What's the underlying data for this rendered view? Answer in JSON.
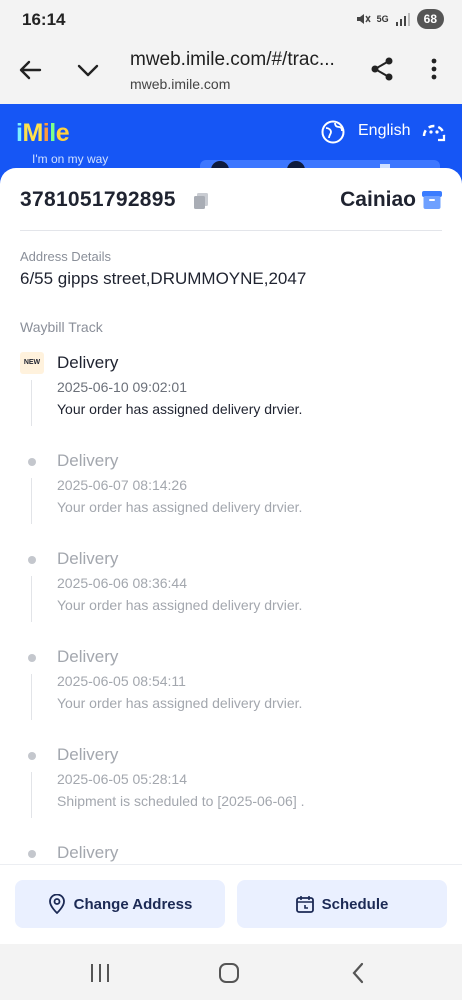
{
  "status_bar": {
    "time": "16:14",
    "network": "5G",
    "battery": "68",
    "icons": [
      "mute-icon",
      "signal-icon",
      "battery-icon"
    ]
  },
  "browser": {
    "url_main": "mweb.imile.com/#/trac...",
    "url_sub": "mweb.imile.com",
    "icons": [
      "back-arrow-icon",
      "chevron-down-icon",
      "share-icon",
      "more-vert-icon"
    ]
  },
  "header": {
    "logo": "iMile",
    "logo_colors": [
      "#7cf0ff",
      "#ffe14d",
      "#ff9a3d",
      "#7dff8a",
      "#ffd23f"
    ],
    "tagline": "I'm on my way",
    "language": "English",
    "accent_color": "#1656f5",
    "icons": [
      "globe-icon",
      "headset-icon"
    ]
  },
  "shipment": {
    "tracking_number": "3781051792895",
    "carrier": "Cainiao",
    "address_label": "Address Details",
    "address_value": "6/55 gipps street,DRUMMOYNE,2047",
    "waybill_label": "Waybill Track",
    "icons": [
      "copy-icon",
      "carrier-box-icon"
    ]
  },
  "timeline": [
    {
      "badge": "NEW",
      "title": "Delivery",
      "time": "2025-06-10 09:02:01",
      "desc": "Your order has assigned delivery drvier."
    },
    {
      "title": "Delivery",
      "time": "2025-06-07 08:14:26",
      "desc": "Your order has assigned delivery drvier."
    },
    {
      "title": "Delivery",
      "time": "2025-06-06 08:36:44",
      "desc": "Your order has assigned delivery drvier."
    },
    {
      "title": "Delivery",
      "time": "2025-06-05 08:54:11",
      "desc": "Your order has assigned delivery drvier."
    },
    {
      "title": "Delivery",
      "time": "2025-06-05 05:28:14",
      "desc": "Shipment is scheduled to [2025-06-06] ."
    },
    {
      "title": "Delivery",
      "time": "",
      "desc": ""
    }
  ],
  "actions": {
    "change_address": "Change Address",
    "schedule": "Schedule",
    "icons": [
      "location-pin-icon",
      "calendar-icon"
    ]
  },
  "nav_bar": {
    "icons": [
      "recent-apps-icon",
      "home-icon",
      "back-icon"
    ]
  }
}
